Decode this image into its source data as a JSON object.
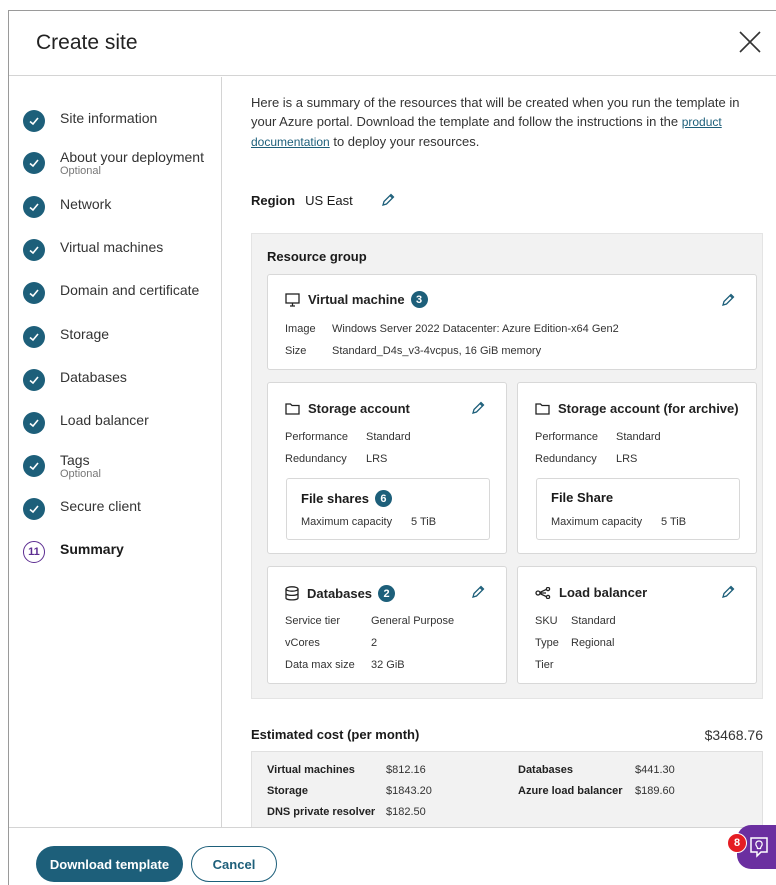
{
  "dialog": {
    "title": "Create site"
  },
  "steps": [
    {
      "label": "Site information",
      "optional": ""
    },
    {
      "label": "About your deployment",
      "optional": "Optional"
    },
    {
      "label": "Network",
      "optional": ""
    },
    {
      "label": "Virtual machines",
      "optional": ""
    },
    {
      "label": "Domain and certificate",
      "optional": ""
    },
    {
      "label": "Storage",
      "optional": ""
    },
    {
      "label": "Databases",
      "optional": ""
    },
    {
      "label": "Load balancer",
      "optional": ""
    },
    {
      "label": "Tags",
      "optional": "Optional"
    },
    {
      "label": "Secure client",
      "optional": ""
    },
    {
      "label": "Summary",
      "number": "11"
    }
  ],
  "intro": {
    "text": "Here is a summary of the resources that will be created when you run the template in your Azure portal. Download the template and follow the instructions in the ",
    "link": "product documentation",
    "suffix": " to deploy your resources."
  },
  "region": {
    "label": "Region",
    "value": "US East"
  },
  "resource_group": {
    "title": "Resource group",
    "vm": {
      "title": "Virtual machine",
      "count": "3",
      "image_label": "Image",
      "image_value": "Windows Server 2022 Datacenter: Azure Edition-x64 Gen2",
      "size_label": "Size",
      "size_value": "Standard_D4s_v3-4vcpus, 16 GiB memory"
    },
    "storage": {
      "title": "Storage account",
      "performance_label": "Performance",
      "performance_value": "Standard",
      "redundancy_label": "Redundancy",
      "redundancy_value": "LRS",
      "file_shares_title": "File shares",
      "file_shares_count": "6",
      "max_cap_label": "Maximum capacity",
      "max_cap_value": "5 TiB"
    },
    "archive": {
      "title": "Storage account (for archive)",
      "performance_label": "Performance",
      "performance_value": "Standard",
      "redundancy_label": "Redundancy",
      "redundancy_value": "LRS",
      "file_share_title": "File Share",
      "max_cap_label": "Maximum capacity",
      "max_cap_value": "5 TiB"
    },
    "databases": {
      "title": "Databases",
      "count": "2",
      "tier_label": "Service tier",
      "tier_value": "General Purpose",
      "vcores_label": "vCores",
      "vcores_value": "2",
      "size_label": "Data max size",
      "size_value": "32 GiB"
    },
    "lb": {
      "title": "Load balancer",
      "sku_label": "SKU",
      "sku_value": "Standard",
      "type_label": "Type",
      "type_value": "Regional",
      "tier_label": "Tier",
      "tier_value": ""
    }
  },
  "cost": {
    "title": "Estimated cost (per month)",
    "total": "$3468.76",
    "items": [
      {
        "label": "Virtual machines",
        "value": "$812.16"
      },
      {
        "label": "Storage",
        "value": "$1843.20"
      },
      {
        "label": "DNS private resolver",
        "value": "$182.50"
      },
      {
        "label": "Databases",
        "value": "$441.30"
      },
      {
        "label": "Azure load balancer",
        "value": "$189.60"
      }
    ]
  },
  "footer": {
    "primary": "Download template",
    "secondary": "Cancel"
  },
  "help": {
    "badge": "8"
  },
  "colors": {
    "accent": "#1d5f7a",
    "purple": "#6b2fa0",
    "badge_red": "#e51c23"
  }
}
